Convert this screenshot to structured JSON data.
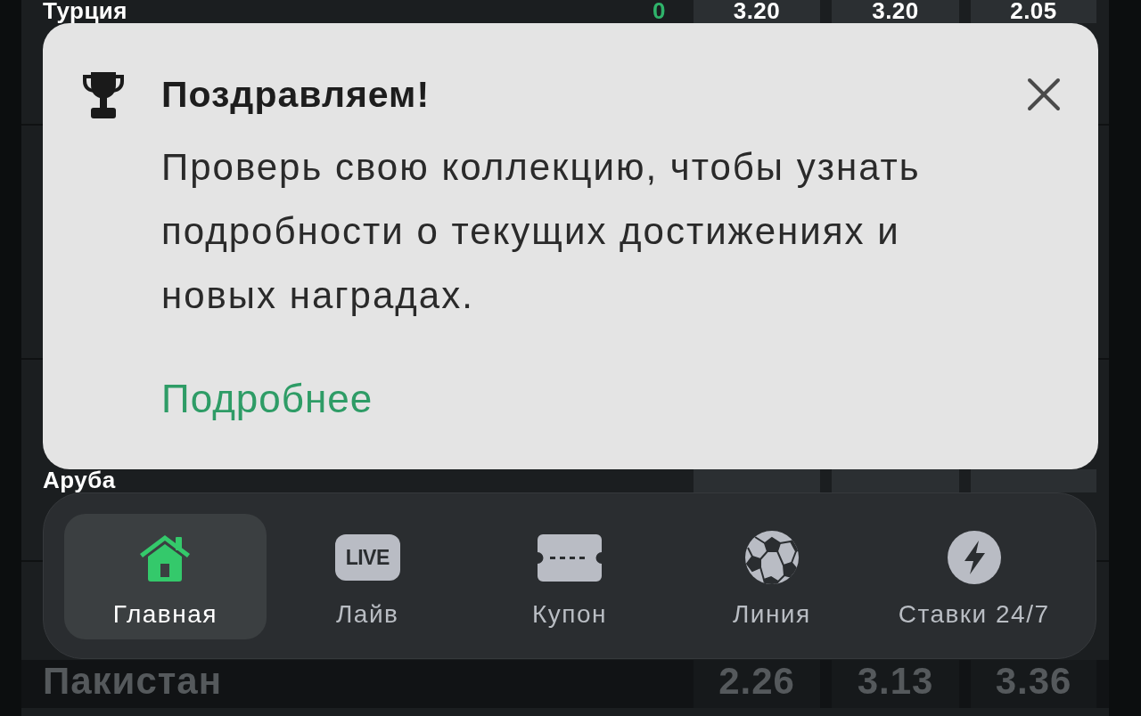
{
  "matches": [
    {
      "team": "Турция",
      "score": "0",
      "odds": [
        "3.20",
        "3.20",
        "2.05"
      ]
    },
    {
      "team": "Аруба"
    },
    {
      "team": "Пакистан",
      "odds": [
        "2.26",
        "3.13",
        "3.36"
      ]
    }
  ],
  "popup": {
    "title": "Поздравляем!",
    "message": "Проверь свою коллекцию, чтобы узнать подробности о текущих достижениях и новых наградах.",
    "link": "Подробнее"
  },
  "nav": {
    "items": [
      {
        "label": "Главная",
        "selected": true
      },
      {
        "label": "Лайв",
        "badge": "LIVE",
        "selected": false
      },
      {
        "label": "Купон",
        "selected": false
      },
      {
        "label": "Линия",
        "selected": false
      },
      {
        "label": "Ставки 24/7",
        "selected": false
      }
    ]
  }
}
